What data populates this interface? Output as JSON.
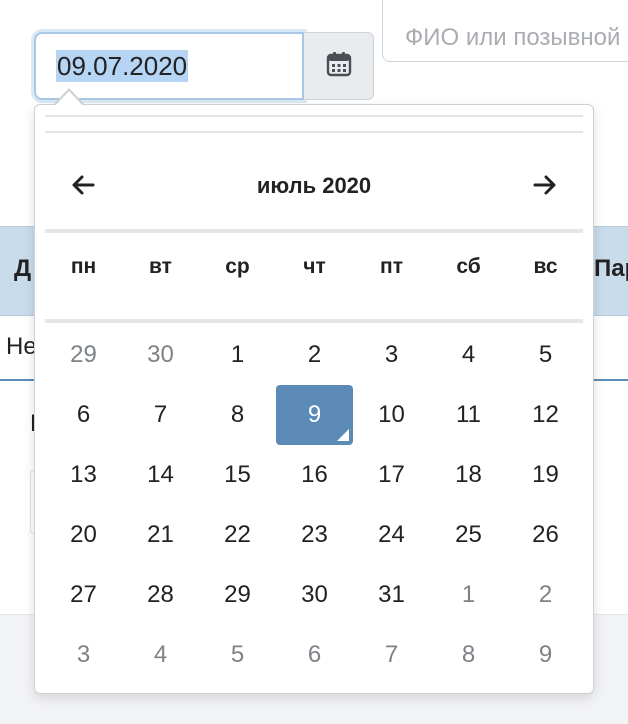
{
  "background": {
    "search_placeholder": "ФИО или позывной",
    "table_header_left": "Д",
    "table_header_right": "Пар",
    "table_row_left": "Не",
    "below_text": "Н"
  },
  "date_input": {
    "value": "09.07.2020"
  },
  "calendar_button": {
    "icon": "calendar-icon"
  },
  "datepicker": {
    "title": "июль 2020",
    "prev_icon": "arrow-left-icon",
    "next_icon": "arrow-right-icon",
    "weekdays": [
      "пн",
      "вт",
      "ср",
      "чт",
      "пт",
      "сб",
      "вс"
    ],
    "weeks": [
      [
        {
          "label": "29",
          "muted": true
        },
        {
          "label": "30",
          "muted": true
        },
        {
          "label": "1"
        },
        {
          "label": "2"
        },
        {
          "label": "3"
        },
        {
          "label": "4"
        },
        {
          "label": "5"
        }
      ],
      [
        {
          "label": "6"
        },
        {
          "label": "7"
        },
        {
          "label": "8"
        },
        {
          "label": "9",
          "active": true,
          "today": true
        },
        {
          "label": "10"
        },
        {
          "label": "11"
        },
        {
          "label": "12"
        }
      ],
      [
        {
          "label": "13"
        },
        {
          "label": "14"
        },
        {
          "label": "15"
        },
        {
          "label": "16"
        },
        {
          "label": "17"
        },
        {
          "label": "18"
        },
        {
          "label": "19"
        }
      ],
      [
        {
          "label": "20"
        },
        {
          "label": "21"
        },
        {
          "label": "22"
        },
        {
          "label": "23"
        },
        {
          "label": "24"
        },
        {
          "label": "25"
        },
        {
          "label": "26"
        }
      ],
      [
        {
          "label": "27"
        },
        {
          "label": "28"
        },
        {
          "label": "29"
        },
        {
          "label": "30"
        },
        {
          "label": "31"
        },
        {
          "label": "1",
          "muted": true
        },
        {
          "label": "2",
          "muted": true
        }
      ],
      [
        {
          "label": "3",
          "muted": true
        },
        {
          "label": "4",
          "muted": true
        },
        {
          "label": "5",
          "muted": true
        },
        {
          "label": "6",
          "muted": true
        },
        {
          "label": "7",
          "muted": true
        },
        {
          "label": "8",
          "muted": true
        },
        {
          "label": "9",
          "muted": true
        }
      ]
    ]
  },
  "colors": {
    "active_day_bg": "#5b8ab6",
    "table_header_bg": "#c9dcec",
    "input_focus_border": "#a8c8e6",
    "muted_text": "#7d8287"
  }
}
